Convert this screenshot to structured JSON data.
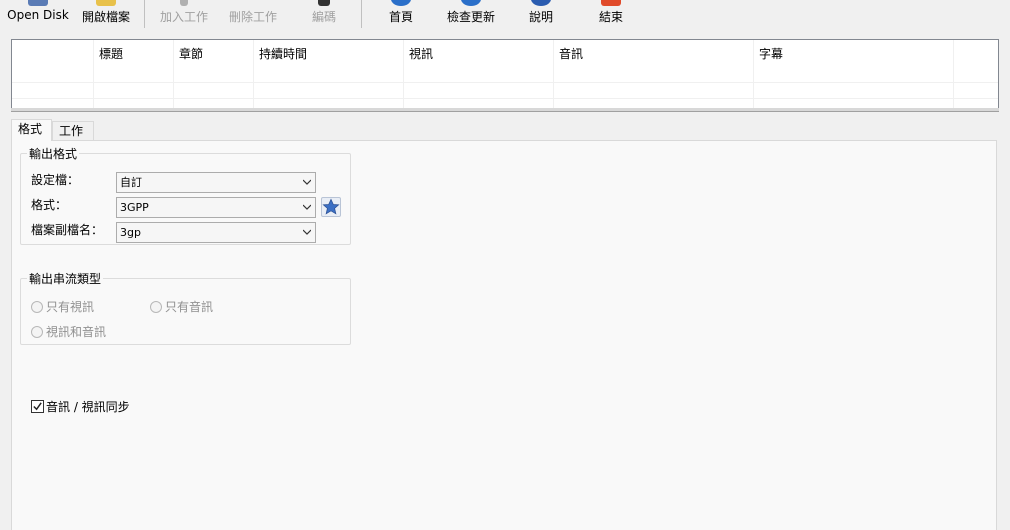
{
  "toolbar": {
    "buttons": [
      {
        "label": "Open Disk",
        "icon": "disk-icon",
        "enabled": true,
        "color": "#5a7bb5"
      },
      {
        "label": "開啟檔案",
        "icon": "folder-icon",
        "enabled": true,
        "color": "#e8c14a"
      },
      {
        "label": "加入工作",
        "icon": "add-task-icon",
        "enabled": false,
        "color": "#9a9a9a"
      },
      {
        "label": "刪除工作",
        "icon": "delete-task-icon",
        "enabled": false,
        "color": "#9a9a9a"
      },
      {
        "label": "編碼",
        "icon": "encode-icon",
        "enabled": false,
        "color": "#333333"
      },
      {
        "label": "首頁",
        "icon": "home-icon",
        "enabled": true,
        "color": "#2a6fc9"
      },
      {
        "label": "檢查更新",
        "icon": "update-icon",
        "enabled": true,
        "color": "#2a6fc9"
      },
      {
        "label": "說明",
        "icon": "help-icon",
        "enabled": true,
        "color": "#2a5cb0"
      },
      {
        "label": "結束",
        "icon": "exit-icon",
        "enabled": true,
        "color": "#e04a2a"
      }
    ]
  },
  "titlelist": {
    "columns": [
      "",
      "標題",
      "章節",
      "持續時間",
      "視訊",
      "音訊",
      "字幕",
      ""
    ]
  },
  "tabs": {
    "format_label": "格式",
    "task_label": "工作"
  },
  "output_format": {
    "title": "輸出格式",
    "profile_label": "設定檔：",
    "profile_value": "自訂",
    "format_label": "格式：",
    "format_value": "3GPP",
    "ext_label": "檔案副檔名：",
    "ext_value": "3gp",
    "star_icon": "star-icon"
  },
  "stream_type": {
    "title": "輸出串流類型",
    "video_only": "只有視訊",
    "audio_only": "只有音訊",
    "video_audio": "視訊和音訊"
  },
  "sync": {
    "label": "音訊 / 視訊同步",
    "checked": true
  }
}
